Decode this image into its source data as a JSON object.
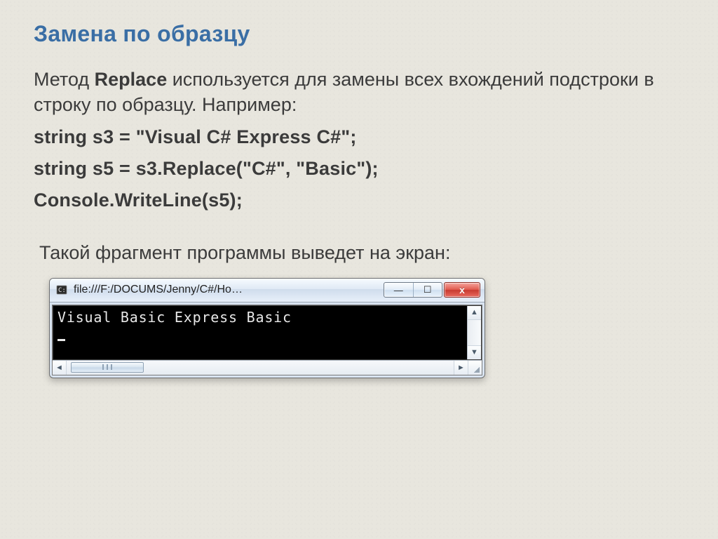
{
  "slide": {
    "title": "Замена по образцу",
    "intro_prefix": "Метод ",
    "intro_bold": "Replace",
    "intro_suffix": " используется для  замены всех вхождений подстроки в строку по образцу. Например:",
    "code_lines": [
      "string s3 = \"Visual C# Express C#\";",
      "string s5 = s3.Replace(\"C#\", \"Basic\");",
      "Console.WriteLine(s5);"
    ],
    "lead_text": "Такой фрагмент программы выведет на экран:"
  },
  "console": {
    "window_title": "file:///F:/DOCUMS/Jenny/C#/Ho…",
    "output_line": "Visual Basic Express Basic",
    "buttons": {
      "minimize": "—",
      "maximize": "☐",
      "close": "x"
    },
    "scroll": {
      "up": "▲",
      "down": "▼",
      "left": "◄",
      "right": "►"
    }
  }
}
